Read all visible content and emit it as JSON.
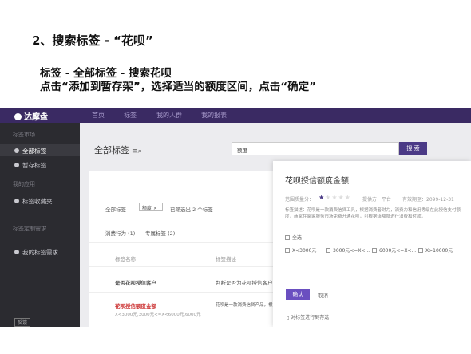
{
  "slide": {
    "heading": "2、搜索标签 - “花呗”",
    "line1": "标签 - 全部标签 - 搜索花呗",
    "line2": "点击“添加到暂存架”，选择适当的额度区间，点击“确定”"
  },
  "app": {
    "logo": "达摩盘",
    "nav": [
      "首页",
      "标签",
      "我的人群",
      "我的报表"
    ]
  },
  "sidebar": {
    "section1": "标签市场",
    "items1": [
      "全部标签",
      "暂存标签"
    ],
    "section2": "我的应用",
    "items2": [
      "标签收藏夹"
    ],
    "section3": "标签定制需求",
    "items3": [
      "我的标签需求"
    ],
    "button": "反馈"
  },
  "main": {
    "title": "全部标签",
    "search_value": "额度",
    "search_button": "搜 索",
    "filter_label": "全部标签",
    "filter_chip": "额度 ×",
    "filter_count": "已筛选出 2 个标签",
    "sort1": "消费行为 (1)",
    "sort2": "专属标签 (2)",
    "col1": "标签名称",
    "col2": "标签描述",
    "row1_name": "是否花呗授信客户",
    "row1_desc": "判断是否为花呗授信客户",
    "row2_name": "花呗授信额度金额",
    "row2_sub": "X<3000元,3000元<=X<6000元,6000元",
    "row2_desc": "花呗是一款消费信贷产品，根据消费者购买力进行授信，消费者在家家服务的花呗服务"
  },
  "modal": {
    "title": "花呗授信额度金额",
    "quality_label": "范围质量分：",
    "stars_on": 1,
    "stars_total": 5,
    "source": "提供方：平台",
    "updated": "有效期至：2099-12-31",
    "desc": "标签描述：花呗是一款消费信贷工具，根据消费者财力，消费力和信用等级在此授信支付额度，商家在家家服务市场免费开通花呗，可根据该额度进行消费和付款。",
    "options": [
      "全选",
      "X<3000元",
      "3000元<=X<...",
      "6000元<=X<...",
      "X>10000元"
    ],
    "ok": "确认",
    "cancel": "取消",
    "note": "对标签进行到存选"
  }
}
